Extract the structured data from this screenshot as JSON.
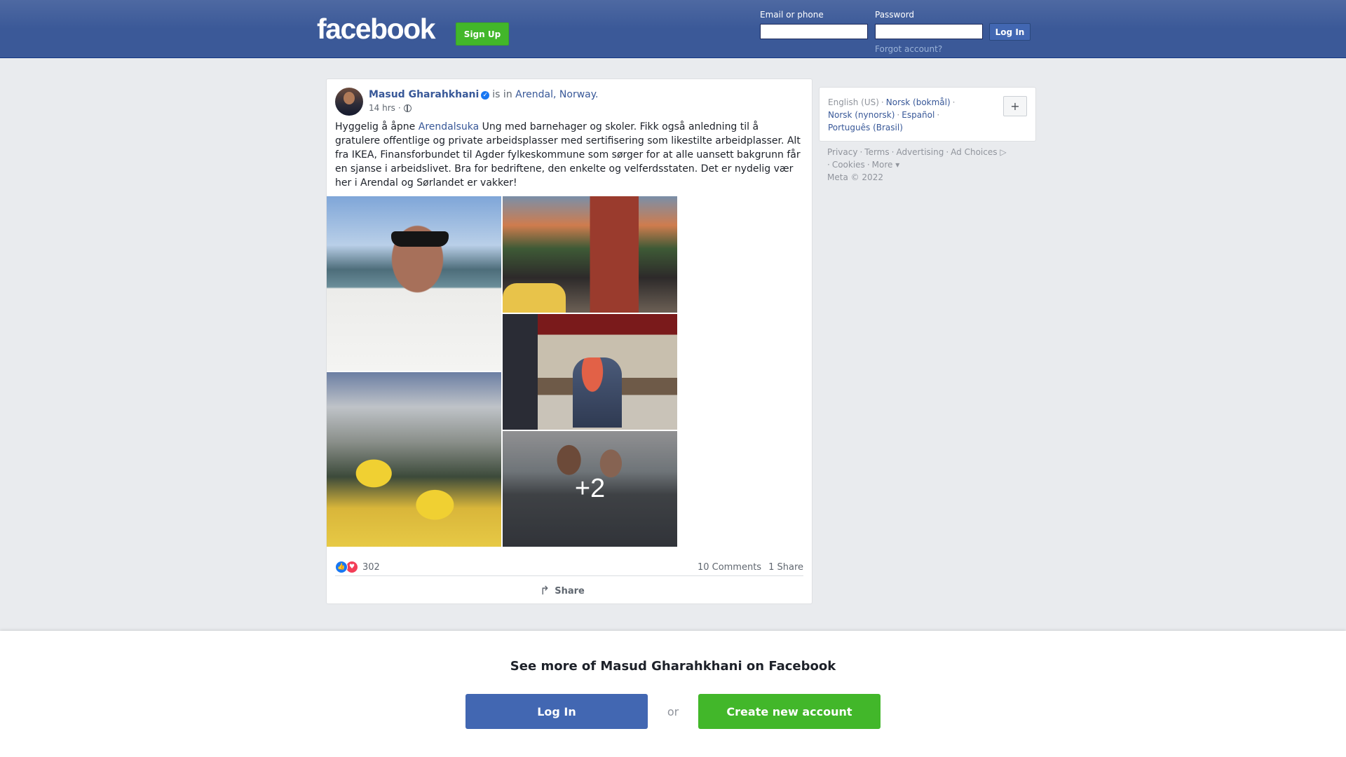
{
  "header": {
    "logo": "facebook",
    "signup_label": "Sign Up",
    "email_label": "Email or phone",
    "password_label": "Password",
    "login_label": "Log In",
    "forgot_label": "Forgot account?"
  },
  "post": {
    "author": "Masud Gharahkhani",
    "is_in": "is in",
    "location": "Arendal, Norway.",
    "time": "14 hrs",
    "text_before_link": "Hyggelig å åpne ",
    "hashtag_link": "Arendalsuka",
    "text_after_link": " Ung med barnehager og skoler. Fikk også anledning til å gratulere offentlige og private arbeidsplasser med sertifisering som likestilte arbeidplasser. Alt fra IKEA, Finansforbundet til Agder fylkeskommune som sørger for at alle uansett bakgrunn får en sjanse i arbeidslivet. Bra for bedriftene, den enkelte og velferdsstaten. Det er nydelig vær her i Arendal og Sørlandet er vakker!",
    "more_photos": "+2",
    "reaction_count": "302",
    "comments": "10 Comments",
    "shares": "1 Share",
    "share_action": "Share"
  },
  "sidebar": {
    "languages": [
      "English (US)",
      "Norsk (bokmål)",
      "Norsk (nynorsk)",
      "Español",
      "Português (Brasil)"
    ],
    "plus": "+",
    "footer_links": [
      "Privacy",
      "Terms",
      "Advertising",
      "Ad Choices",
      "Cookies",
      "More"
    ],
    "copyright": "Meta © 2022"
  },
  "bottom": {
    "title": "See more of Masud Gharahkhani on Facebook",
    "login": "Log In",
    "or": "or",
    "create": "Create new account"
  },
  "colors": {
    "brand_blue": "#3b5998",
    "button_blue": "#4267b2",
    "green": "#42b72a",
    "link": "#385898"
  }
}
